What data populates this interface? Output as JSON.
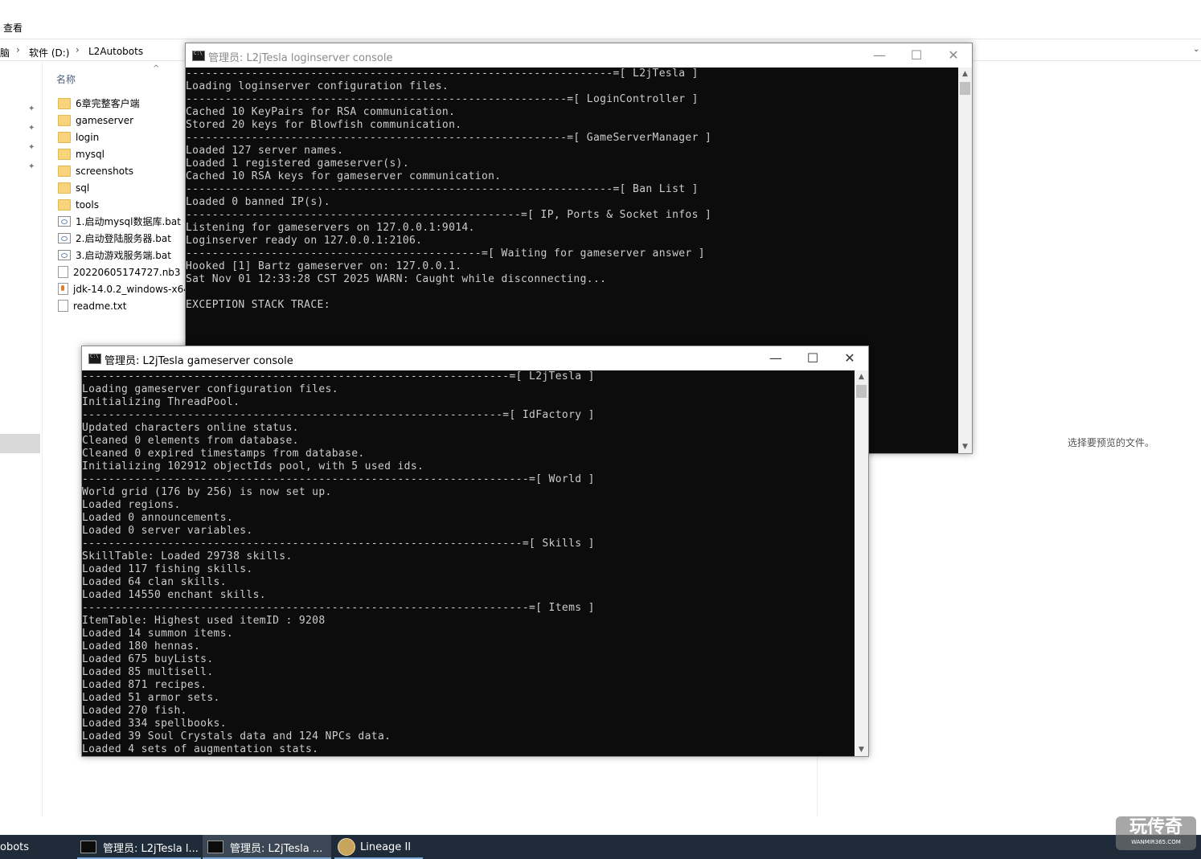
{
  "explorer": {
    "menu_view": "查看",
    "breadcrumb": [
      "脑",
      "软件 (D:)",
      "L2Autobots"
    ],
    "column_name": "名称",
    "files": [
      {
        "name": "6章完整客户端",
        "type": "folder"
      },
      {
        "name": "gameserver",
        "type": "folder"
      },
      {
        "name": "login",
        "type": "folder"
      },
      {
        "name": "mysql",
        "type": "folder"
      },
      {
        "name": "screenshots",
        "type": "folder"
      },
      {
        "name": "sql",
        "type": "folder"
      },
      {
        "name": "tools",
        "type": "folder"
      },
      {
        "name": "1.启动mysql数据库.bat",
        "type": "bat"
      },
      {
        "name": "2.启动登陆服务器.bat",
        "type": "bat"
      },
      {
        "name": "3.启动游戏服务端.bat",
        "type": "bat"
      },
      {
        "name": "20220605174727.nb3",
        "type": "file"
      },
      {
        "name": "jdk-14.0.2_windows-x64",
        "type": "jar"
      },
      {
        "name": "readme.txt",
        "type": "file"
      }
    ],
    "preview_text": "选择要预览的文件。"
  },
  "login_console": {
    "title": "管理员:  L2jTesla loginserver console",
    "lines": [
      "-----------------------------------------------------------------=[ L2jTesla ]",
      "Loading loginserver configuration files.",
      "----------------------------------------------------------=[ LoginController ]",
      "Cached 10 KeyPairs for RSA communication.",
      "Stored 20 keys for Blowfish communication.",
      "----------------------------------------------------------=[ GameServerManager ]",
      "Loaded 127 server names.",
      "Loaded 1 registered gameserver(s).",
      "Cached 10 RSA keys for gameserver communication.",
      "-----------------------------------------------------------------=[ Ban List ]",
      "Loaded 0 banned IP(s).",
      "---------------------------------------------------=[ IP, Ports & Socket infos ]",
      "Listening for gameservers on 127.0.0.1:9014.",
      "Loginserver ready on 127.0.0.1:2106.",
      "---------------------------------------------=[ Waiting for gameserver answer ]",
      "Hooked [1] Bartz gameserver on: 127.0.0.1.",
      "Sat Nov 01 12:33:28 CST 2025 WARN: Caught while disconnecting...",
      "",
      "EXCEPTION STACK TRACE:"
    ]
  },
  "game_console": {
    "title": "管理员:  L2jTesla gameserver console",
    "lines": [
      "-----------------------------------------------------------------=[ L2jTesla ]",
      "Loading gameserver configuration files.",
      "Initializing ThreadPool.",
      "----------------------------------------------------------------=[ IdFactory ]",
      "Updated characters online status.",
      "Cleaned 0 elements from database.",
      "Cleaned 0 expired timestamps from database.",
      "Initializing 102912 objectIds pool, with 5 used ids.",
      "--------------------------------------------------------------------=[ World ]",
      "World grid (176 by 256) is now set up.",
      "Loaded regions.",
      "Loaded 0 announcements.",
      "Loaded 0 server variables.",
      "-------------------------------------------------------------------=[ Skills ]",
      "SkillTable: Loaded 29738 skills.",
      "Loaded 117 fishing skills.",
      "Loaded 64 clan skills.",
      "Loaded 14550 enchant skills.",
      "--------------------------------------------------------------------=[ Items ]",
      "ItemTable: Highest used itemID : 9208",
      "Loaded 14 summon items.",
      "Loaded 180 hennas.",
      "Loaded 675 buyLists.",
      "Loaded 85 multisell.",
      "Loaded 871 recipes.",
      "Loaded 51 armor sets.",
      "Loaded 270 fish.",
      "Loaded 334 spellbooks.",
      "Loaded 39 Soul Crystals data and 124 NPCs data.",
      "Loaded 4 sets of augmentation stats."
    ]
  },
  "window_buttons": {
    "minimize": "—",
    "maximize": "☐",
    "close": "✕"
  },
  "taskbar": {
    "items": [
      "obots",
      "管理员:  L2jTesla l...",
      "管理员:  L2jTesla ...",
      "Lineage II"
    ]
  },
  "watermark": {
    "main": "玩传奇",
    "sub": "WANMIR365.COM"
  }
}
